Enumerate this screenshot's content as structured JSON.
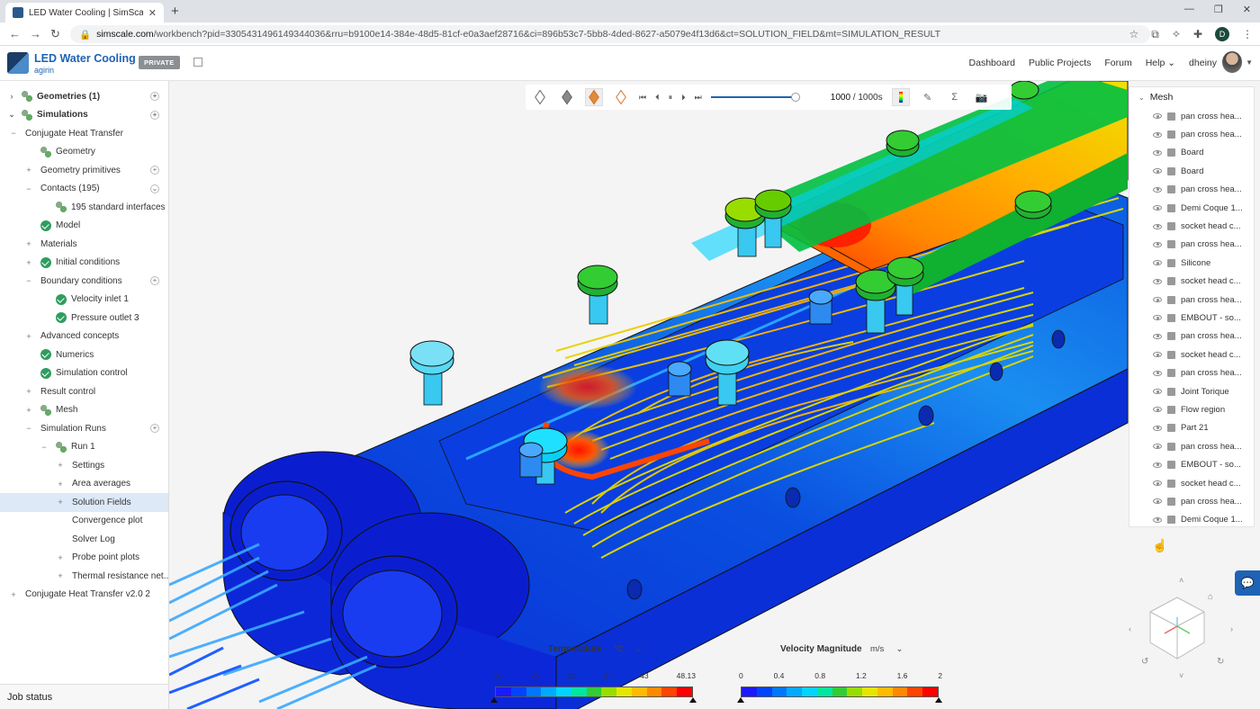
{
  "browser": {
    "tab_title": "LED Water Cooling | SimScale W",
    "url_domain": "simscale.com",
    "url_path": "/workbench?pid=3305431496149344036&rru=b9100e14-384e-48d5-81cf-e0a3aef28716&ci=896b53c7-5bb8-4ded-8627-a5079e4f13d6&ct=SOLUTION_FIELD&mt=SIMULATION_RESULT",
    "profile_initial": "D"
  },
  "header": {
    "project_title": "LED Water Cooling",
    "project_owner": "agirin",
    "privacy_badge": "PRIVATE",
    "nav": [
      "Dashboard",
      "Public Projects",
      "Forum",
      "Help"
    ],
    "username": "dheiny"
  },
  "tree": [
    {
      "label": "Geometries (1)",
      "level": 0,
      "bold": true,
      "toggle": "›",
      "icon": "cubes",
      "plus": true
    },
    {
      "label": "Simulations",
      "level": 0,
      "bold": true,
      "toggle": "⌄",
      "icon": "cubes",
      "plus": true
    },
    {
      "label": "Conjugate Heat Transfer",
      "level": 1,
      "toggle": "−"
    },
    {
      "label": "Geometry",
      "level": 2,
      "icon": "cubes-check"
    },
    {
      "label": "Geometry primitives",
      "level": 2,
      "toggle": "+",
      "plus": true
    },
    {
      "label": "Contacts (195)",
      "level": 2,
      "toggle": "−",
      "plus": true
    },
    {
      "label": "195 standard interfaces",
      "level": 3,
      "icon": "copy-check"
    },
    {
      "label": "Model",
      "level": 2,
      "icon": "check"
    },
    {
      "label": "Materials",
      "level": 2,
      "toggle": "+"
    },
    {
      "label": "Initial conditions",
      "level": 2,
      "toggle": "+",
      "icon": "check"
    },
    {
      "label": "Boundary conditions",
      "level": 2,
      "toggle": "−",
      "plus": true
    },
    {
      "label": "Velocity inlet 1",
      "level": 3,
      "icon": "check"
    },
    {
      "label": "Pressure outlet 3",
      "level": 3,
      "icon": "check"
    },
    {
      "label": "Advanced concepts",
      "level": 2,
      "toggle": "+"
    },
    {
      "label": "Numerics",
      "level": 2,
      "icon": "check"
    },
    {
      "label": "Simulation control",
      "level": 2,
      "icon": "check"
    },
    {
      "label": "Result control",
      "level": 2,
      "toggle": "+"
    },
    {
      "label": "Mesh",
      "level": 2,
      "toggle": "+",
      "icon": "cubes-check"
    },
    {
      "label": "Simulation Runs",
      "level": 2,
      "toggle": "−",
      "plus": true
    },
    {
      "label": "Run 1",
      "level": 3,
      "toggle": "−",
      "icon": "gears-check"
    },
    {
      "label": "Settings",
      "level": 4,
      "toggle": "+"
    },
    {
      "label": "Area averages",
      "level": 4,
      "toggle": "+"
    },
    {
      "label": "Solution Fields",
      "level": 4,
      "toggle": "+",
      "selected": true
    },
    {
      "label": "Convergence plot",
      "level": 4
    },
    {
      "label": "Solver Log",
      "level": 4
    },
    {
      "label": "Probe point plots",
      "level": 4,
      "toggle": "+"
    },
    {
      "label": "Thermal resistance net...",
      "level": 4,
      "toggle": "+"
    },
    {
      "label": "Conjugate Heat Transfer v2.0 2",
      "level": 1,
      "toggle": "+"
    }
  ],
  "job_status_label": "Job status",
  "playback": {
    "frame": "1000",
    "total": "/ 1000s"
  },
  "mesh_panel": {
    "title": "Mesh",
    "items": [
      "pan cross hea...",
      "pan cross hea...",
      "Board",
      "Board",
      "pan cross hea...",
      "Demi Coque 1...",
      "socket head c...",
      "pan cross hea...",
      "Silicone",
      "socket head c...",
      "pan cross hea...",
      "EMBOUT - so...",
      "pan cross hea...",
      "socket head c...",
      "pan cross hea...",
      "Joint Torique",
      "Flow region",
      "Part 21",
      "pan cross hea...",
      "EMBOUT - so...",
      "socket head c...",
      "pan cross hea...",
      "Demi Coque 1..."
    ]
  },
  "legends": [
    {
      "title": "Temperature",
      "unit": "°C",
      "ticks": [
        "20",
        "26",
        "31",
        "37",
        "43",
        "48.13"
      ]
    },
    {
      "title": "Velocity Magnitude",
      "unit": "m/s",
      "ticks": [
        "0",
        "0.4",
        "0.8",
        "1.2",
        "1.6",
        "2"
      ]
    }
  ],
  "colormap": [
    "#1a1aff",
    "#0044ff",
    "#0077ff",
    "#00aaff",
    "#00d5ff",
    "#00e5a0",
    "#33cc33",
    "#99dd00",
    "#e6e600",
    "#ffbb00",
    "#ff8800",
    "#ff4400",
    "#ff0000"
  ]
}
